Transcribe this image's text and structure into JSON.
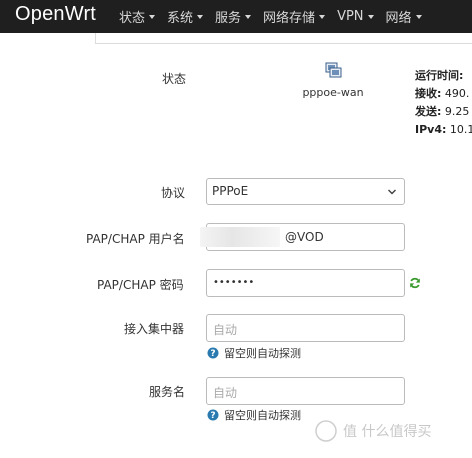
{
  "nav": {
    "brand": "OpenWrt",
    "items": [
      {
        "label": "状态"
      },
      {
        "label": "系统"
      },
      {
        "label": "服务"
      },
      {
        "label": "网络存储"
      },
      {
        "label": "VPN"
      },
      {
        "label": "网络"
      }
    ]
  },
  "form": {
    "status_label": "状态",
    "interface_name": "pppoe-wan",
    "stats": {
      "uptime_label": "运行时间:",
      "rx_label": "接收:",
      "rx_value": "490.",
      "tx_label": "发送:",
      "tx_value": "9.25",
      "ipv4_label": "IPv4:",
      "ipv4_value": "10.1"
    },
    "protocol_label": "协议",
    "protocol_value": "PPPoE",
    "username_label": "PAP/CHAP 用户名",
    "username_value": "@VOD",
    "password_label": "PAP/CHAP 密码",
    "password_value": "•••••••",
    "ac_label": "接入集中器",
    "ac_placeholder": "自动",
    "ac_hint": "留空则自动探测",
    "service_label": "服务名",
    "service_placeholder": "自动",
    "service_hint": "留空则自动探测"
  },
  "watermark": {
    "text": "值 什么值得买"
  },
  "colors": {
    "topbar": "#1f1f1f",
    "refresh_green": "#3a9a2e",
    "hint_blue": "#2a7ab0"
  }
}
